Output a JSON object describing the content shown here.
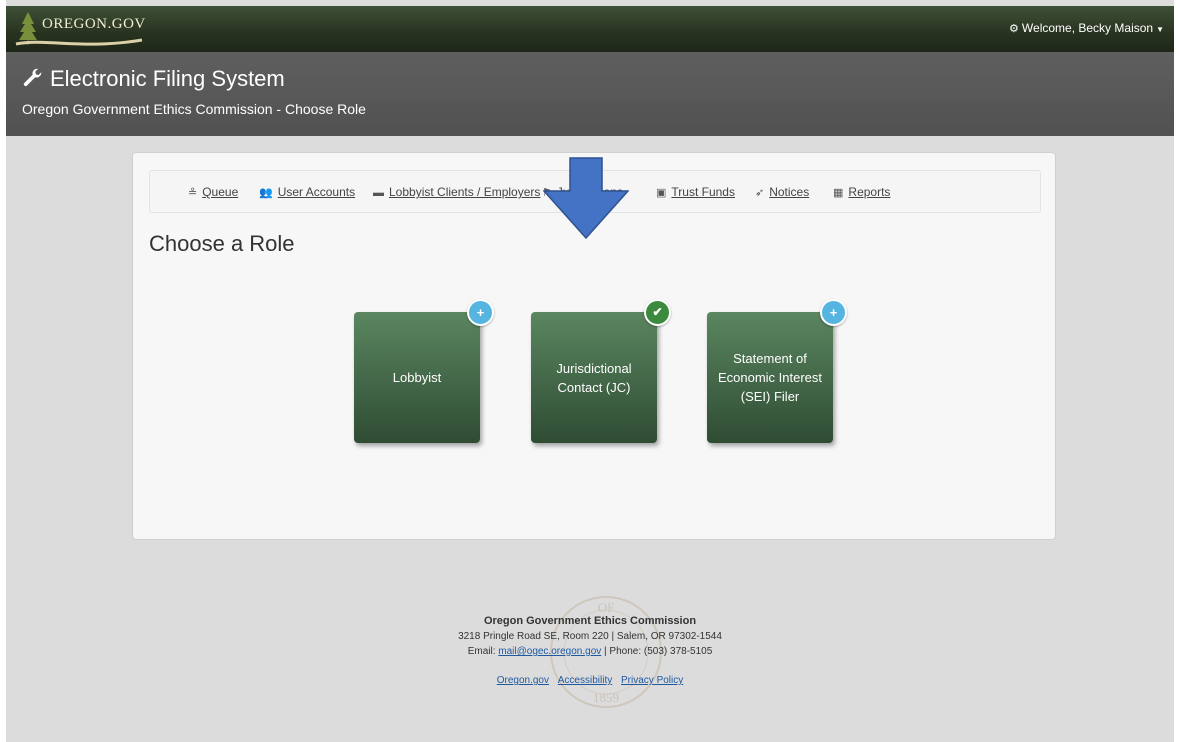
{
  "topbar": {
    "logo_text": "OREGON.GOV",
    "welcome": "Welcome, Becky Maison"
  },
  "header": {
    "title": "Electronic Filing System",
    "subtitle": "Oregon Government Ethics Commission - Choose Role"
  },
  "nav": {
    "items": [
      {
        "label": "Queue",
        "icon": "queue-icon"
      },
      {
        "label": "User Accounts",
        "icon": "users-icon"
      },
      {
        "label": "Lobbyist Clients / Employers",
        "icon": "briefcase-icon"
      },
      {
        "label": "Jurisdictions",
        "icon": "flag-icon"
      },
      {
        "label": "Trust Funds",
        "icon": "money-icon"
      },
      {
        "label": "Notices",
        "icon": "send-icon"
      },
      {
        "label": "Reports",
        "icon": "table-icon"
      }
    ]
  },
  "main": {
    "heading": "Choose a Role",
    "roles": [
      {
        "label": "Lobbyist",
        "badge": "plus"
      },
      {
        "label": "Jurisdictional Contact (JC)",
        "badge": "check"
      },
      {
        "label": "Statement of Economic Interest (SEI) Filer",
        "badge": "plus"
      }
    ]
  },
  "footer": {
    "org": "Oregon Government Ethics Commission",
    "address": "3218 Pringle Road SE, Room 220 | Salem, OR 97302-1544",
    "email_prefix": "Email: ",
    "email": "mail@ogec.oregon.gov",
    "phone": " | Phone: (503) 378-5105",
    "links": [
      "Oregon.gov",
      "Accessibility",
      "Privacy Policy"
    ],
    "seal_text_top": "OF",
    "seal_year": "1859"
  },
  "colors": {
    "accent_green": "#3c8a3e",
    "badge_blue": "#55b5e0",
    "arrow_blue": "#4472c4",
    "tile_top": "#5a8660",
    "tile_bottom": "#2f4c33"
  }
}
